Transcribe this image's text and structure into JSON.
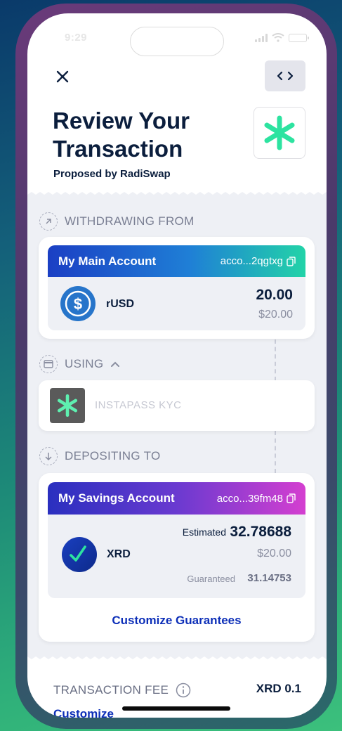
{
  "status_bar": {
    "time": "9:29"
  },
  "header": {
    "title": "Review Your Transaction",
    "subtitle": "Proposed by RadiSwap"
  },
  "withdrawing": {
    "section_label": "WITHDRAWING FROM",
    "account_name": "My Main Account",
    "account_address": "acco...2qgtxg",
    "token_name": "rUSD",
    "amount": "20.00",
    "fiat_value": "$20.00"
  },
  "using": {
    "section_label": "USING",
    "badge_name": "INSTAPASS KYC"
  },
  "depositing": {
    "section_label": "DEPOSITING TO",
    "account_name": "My Savings Account",
    "account_address": "acco...39fm48",
    "token_name": "XRD",
    "estimated_label": "Estimated",
    "estimated_amount": "32.78688",
    "fiat_value": "$20.00",
    "guaranteed_label": "Guaranteed",
    "guaranteed_amount": "31.14753",
    "customize_label": "Customize Guarantees"
  },
  "fee": {
    "label": "TRANSACTION FEE",
    "value": "XRD 0.1",
    "customize_label": "Customize"
  },
  "colors": {
    "main_account_gradient": [
      "#1b3fc4",
      "#1f7fd6",
      "#22d3a8"
    ],
    "savings_account_gradient": [
      "#2a2fbf",
      "#6a3ad0",
      "#d43fd0"
    ],
    "navy_text": "#0b1e3d",
    "link_blue": "#0d2fb8",
    "body_bg": "#eef0f5"
  },
  "icons": {
    "close": "close-icon",
    "code": "code-brackets-icon",
    "dapp": "radiswap-asterisk-icon",
    "copy": "copy-icon",
    "usdc": "usdc-dollar-icon",
    "xrd": "xrd-check-icon",
    "withdraw_arrow": "arrow-up-right-icon",
    "using_card": "card-icon",
    "chevron_up": "chevron-up-icon",
    "deposit_arrow": "arrow-down-icon",
    "info": "info-icon"
  }
}
